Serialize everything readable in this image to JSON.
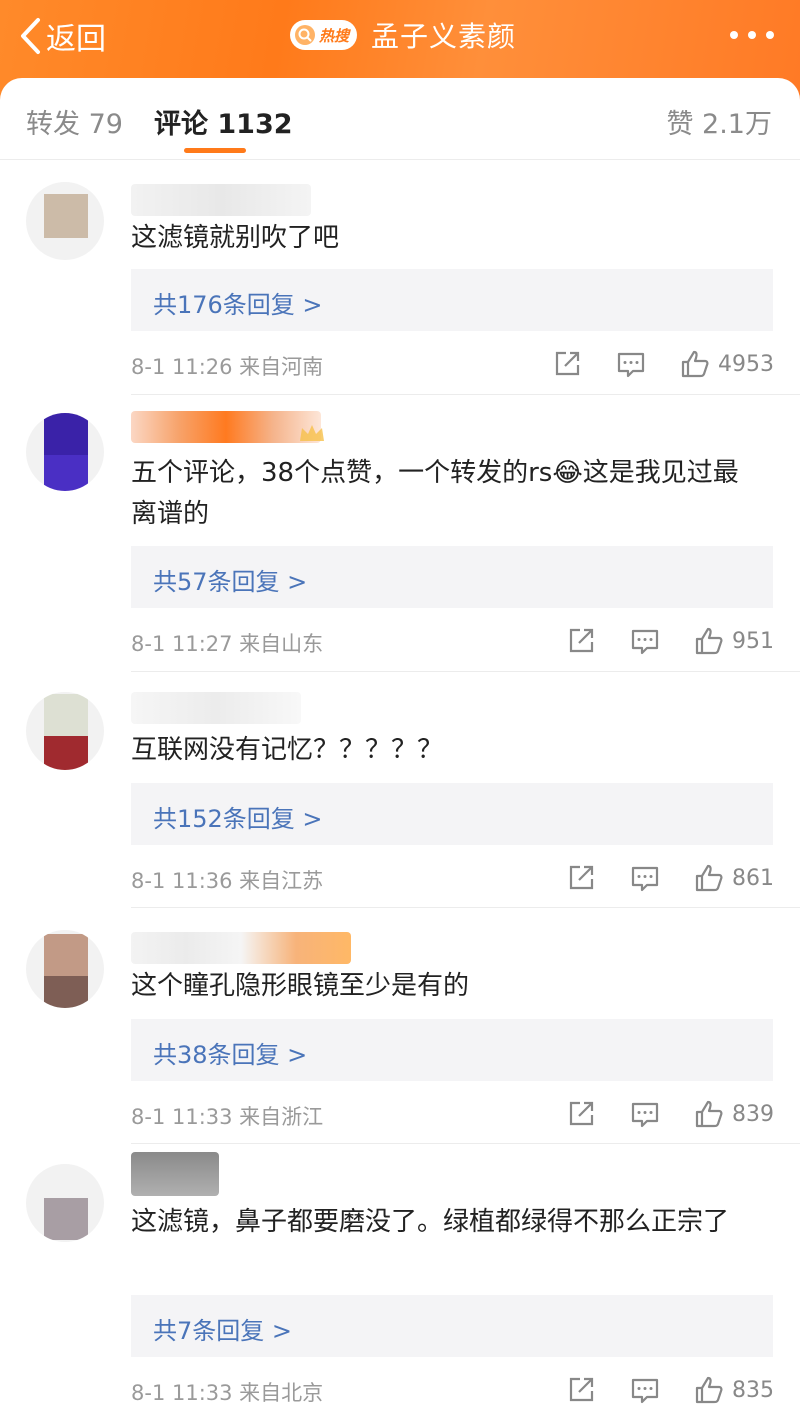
{
  "header": {
    "back_label": "返回",
    "hot_badge": "热搜",
    "title": "孟子义素颜",
    "accent_color": "#ff7a1a"
  },
  "tabs": {
    "repost": "转发 79",
    "comment": "评论 1132",
    "like": "赞 2.1万"
  },
  "comments": [
    {
      "text": "这滤镜就别吹了吧",
      "replies": "共176条回复 >",
      "time_location": "8-1 11:26 来自河南",
      "likes": "4953"
    },
    {
      "text": "五个评论，38个点赞，一个转发的rs😂这是我见过最离谱的",
      "replies": "共57条回复 >",
      "time_location": "8-1 11:27 来自山东",
      "likes": "951"
    },
    {
      "text": "互联网没有记忆？？？？？",
      "replies": "共152条回复 >",
      "time_location": "8-1 11:36 来自江苏",
      "likes": "861"
    },
    {
      "text": "这个瞳孔隐形眼镜至少是有的",
      "replies": "共38条回复 >",
      "time_location": "8-1 11:33 来自浙江",
      "likes": "839"
    },
    {
      "text": "这滤镜，鼻子都要磨没了。绿植都绿得不那么正宗了",
      "replies": "共7条回复 >",
      "time_location": "8-1 11:33 来自北京",
      "likes": "835"
    }
  ]
}
